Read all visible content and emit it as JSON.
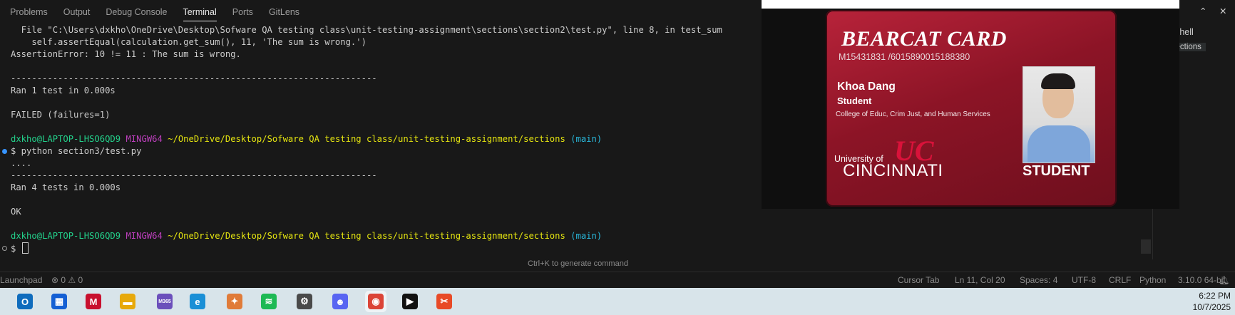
{
  "panel_tabs": [
    "Problems",
    "Output",
    "Debug Console",
    "Terminal",
    "Ports",
    "GitLens"
  ],
  "active_tab": "Terminal",
  "terminal": {
    "lines": [
      "  File \"C:\\Users\\dxkho\\OneDrive\\Desktop\\Sofware QA testing class\\unit-testing-assignment\\sections\\section2\\test.py\", line 8, in test_sum",
      "    self.assertEqual(calculation.get_sum(), 11, 'The sum is wrong.')",
      "AssertionError: 10 != 11 : The sum is wrong.",
      "",
      "----------------------------------------------------------------------",
      "Ran 1 test in 0.000s",
      "",
      "FAILED (failures=1)",
      ""
    ],
    "prompt1": {
      "user": "dxkho@LAPTOP-LHSO6QD9",
      "shell": "MINGW64",
      "path": "~/OneDrive/Desktop/Sofware QA testing class/unit-testing-assignment/sections",
      "branch": "(main)"
    },
    "command": "$ python section3/test.py",
    "output2": [
      "....",
      "----------------------------------------------------------------------",
      "Ran 4 tests in 0.000s",
      "",
      "OK",
      ""
    ],
    "prompt2": {
      "user": "dxkho@LAPTOP-LHSO6QD9",
      "shell": "MINGW64",
      "path": "~/OneDrive/Desktop/Sofware QA testing class/unit-testing-assignment/sections",
      "branch": "(main)"
    },
    "input_prompt": "$ ",
    "hint": "Ctrl+K to generate command"
  },
  "right_pane": {
    "more": "...",
    "items": [
      "owershell",
      "ash sections"
    ]
  },
  "id_card": {
    "title": "BEARCAT CARD",
    "number": "M15431831 /6015890015188380",
    "name": "Khoa Dang",
    "role": "Student",
    "college": "College of Educ, Crim Just, and Human Services",
    "logo": "UC",
    "university_line1": "University of",
    "university_line2": "CINCINNATI",
    "badge": "STUDENT"
  },
  "statusbar": {
    "left": "Launchpad",
    "problems": "⊗ 0 ⚠ 0",
    "cursor_tab": "Cursor Tab",
    "position": "Ln 11, Col 20",
    "spaces": "Spaces: 4",
    "encoding": "UTF-8",
    "eol": "CRLF",
    "language": "Python",
    "interpreter": "3.10.0 64-bit"
  },
  "taskbar": {
    "apps": [
      {
        "icon": "outlook-icon",
        "glyph": "O",
        "color": "#0f6cbd"
      },
      {
        "icon": "store-icon",
        "glyph": "▦",
        "color": "#1560d4"
      },
      {
        "icon": "mcafee-icon",
        "glyph": "M",
        "color": "#c8102e"
      },
      {
        "icon": "file-explorer-icon",
        "glyph": "▬",
        "color": "#e7a90c"
      },
      {
        "icon": "m365-icon",
        "glyph": "M365",
        "color": "#6b4fbb"
      },
      {
        "icon": "edge-icon",
        "glyph": "e",
        "color": "#1a8fd6"
      },
      {
        "icon": "pinwheel-icon",
        "glyph": "✦",
        "color": "#e07b39"
      },
      {
        "icon": "spotify-icon",
        "glyph": "≋",
        "color": "#1db954"
      },
      {
        "icon": "settings-icon",
        "glyph": "⚙",
        "color": "#4a4a4a"
      },
      {
        "icon": "discord-icon",
        "glyph": "☻",
        "color": "#5865f2"
      },
      {
        "icon": "chrome-icon",
        "glyph": "◉",
        "color": "#db4437"
      },
      {
        "icon": "terminal-app-icon",
        "glyph": "▶",
        "color": "#111111"
      },
      {
        "icon": "snipping-tool-icon",
        "glyph": "✂",
        "color": "#e84a27"
      }
    ],
    "time": "6:22 PM",
    "date": "10/7/2025"
  }
}
